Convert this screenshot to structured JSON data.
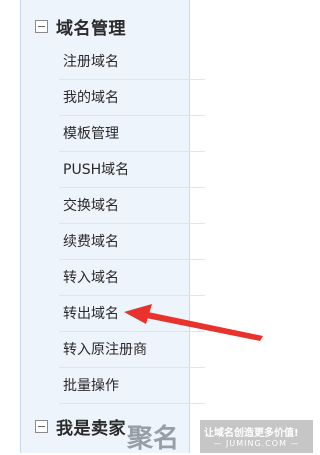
{
  "sections": [
    {
      "title": "域名管理",
      "items": [
        "注册域名",
        "我的域名",
        "模板管理",
        "PUSH域名",
        "交换域名",
        "续费域名",
        "转入域名",
        "转出域名",
        "转入原注册商",
        "批量操作"
      ]
    },
    {
      "title": "我是卖家"
    }
  ],
  "annotation": {
    "color": "#e8322c",
    "points_to": "转出域名"
  },
  "watermark": {
    "logo_text": "聚名",
    "slogan": "让域名创造更多价值!",
    "domain": "— JUMING.COM —"
  }
}
